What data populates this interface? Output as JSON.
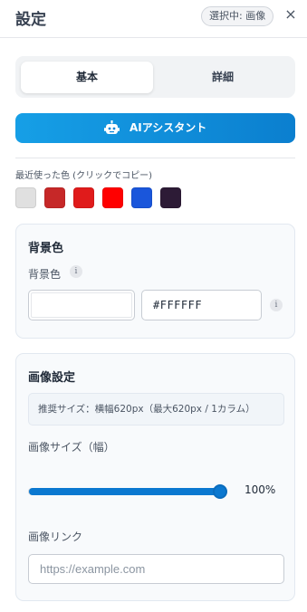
{
  "header": {
    "title": "設定",
    "selection_badge": "選択中: 画像",
    "close_icon": "close-icon",
    "close_glyph": "×"
  },
  "tabs": [
    {
      "label": "基本",
      "active": true
    },
    {
      "label": "詳細",
      "active": false
    }
  ],
  "ai_button": {
    "label": "AIアシスタント",
    "icon": "robot-icon"
  },
  "recent_colors": {
    "label": "最近使った色 (クリックでコピー)",
    "colors": [
      "#e0e0e0",
      "#c62828",
      "#e01b1b",
      "#ff0000",
      "#1a56db",
      "#2d1b36"
    ]
  },
  "background_section": {
    "title": "背景色",
    "field_label": "背景色",
    "info_glyph": "i",
    "color_value": "#FFFFFF",
    "hex_value": "#FFFFFF"
  },
  "image_section": {
    "title": "画像設定",
    "recommendation": "推奨サイズ：横幅620px（最大620px / 1カラム）",
    "size_label": "画像サイズ（幅）",
    "size_value": 97,
    "size_display": "100%",
    "link_label": "画像リンク",
    "link_value": "",
    "link_placeholder": "https://example.com"
  },
  "colors": {
    "accent": "#0b78d0",
    "ai_gradient_start": "#169fe6",
    "ai_gradient_end": "#0b7fcf"
  }
}
